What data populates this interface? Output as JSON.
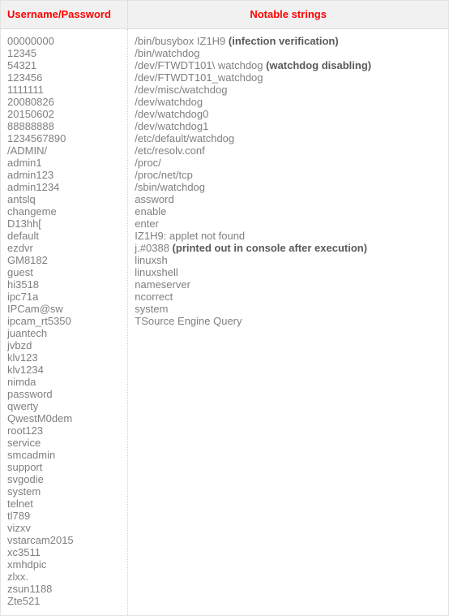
{
  "table": {
    "columns": [
      {
        "key": "credentials",
        "label": "Username/Password",
        "align": "left"
      },
      {
        "key": "strings",
        "label": "Notable strings",
        "align": "center"
      }
    ],
    "header_color": "#ff0000",
    "header_background": "#f1f1f1",
    "body_text_color": "#7f7f7f",
    "note_text_color": "#5a5a5a",
    "border_color": "#e3e3e3",
    "divider_style": "dotted",
    "credentials": [
      "00000000",
      "12345",
      "54321",
      "123456",
      "1111111",
      "20080826",
      "20150602",
      "88888888",
      "1234567890",
      "/ADMIN/",
      "admin1",
      "admin123",
      "admin1234",
      "antslq",
      "changeme",
      "D13hh[",
      "default",
      "ezdvr",
      "GM8182",
      "guest",
      "hi3518",
      "ipc71a",
      "IPCam@sw",
      "ipcam_rt5350",
      "juantech",
      "jvbzd",
      "klv123",
      "klv1234",
      "nimda",
      "password",
      "qwerty",
      "QwestM0dem",
      "root123",
      "service",
      "smcadmin",
      "support",
      "svgodie",
      "system",
      "telnet",
      "tl789",
      "vizxv",
      "vstarcam2015",
      "xc3511",
      "xmhdpic",
      "zlxx.",
      "zsun1188",
      "Zte521"
    ],
    "strings": [
      {
        "text": "/bin/busybox IZ1H9 ",
        "note": "(infection verification)"
      },
      {
        "text": "/bin/watchdog",
        "note": ""
      },
      {
        "text": "/dev/FTWDT101\\ watchdog ",
        "note": "(watchdog disabling)"
      },
      {
        "text": "/dev/FTWDT101_watchdog",
        "note": ""
      },
      {
        "text": "/dev/misc/watchdog",
        "note": ""
      },
      {
        "text": "/dev/watchdog",
        "note": ""
      },
      {
        "text": "/dev/watchdog0",
        "note": ""
      },
      {
        "text": "/dev/watchdog1",
        "note": ""
      },
      {
        "text": "/etc/default/watchdog",
        "note": ""
      },
      {
        "text": "/etc/resolv.conf",
        "note": ""
      },
      {
        "text": "/proc/",
        "note": ""
      },
      {
        "text": "/proc/net/tcp",
        "note": ""
      },
      {
        "text": "/sbin/watchdog",
        "note": ""
      },
      {
        "text": "assword",
        "note": ""
      },
      {
        "text": "enable",
        "note": ""
      },
      {
        "text": "enter",
        "note": ""
      },
      {
        "text": "IZ1H9: applet not found",
        "note": ""
      },
      {
        "text": "j.#0388 ",
        "note": "(printed out in console after execution)"
      },
      {
        "text": "linuxsh",
        "note": ""
      },
      {
        "text": "linuxshell",
        "note": ""
      },
      {
        "text": "nameserver",
        "note": ""
      },
      {
        "text": "ncorrect",
        "note": ""
      },
      {
        "text": "system",
        "note": ""
      },
      {
        "text": "TSource Engine Query",
        "note": ""
      }
    ]
  }
}
